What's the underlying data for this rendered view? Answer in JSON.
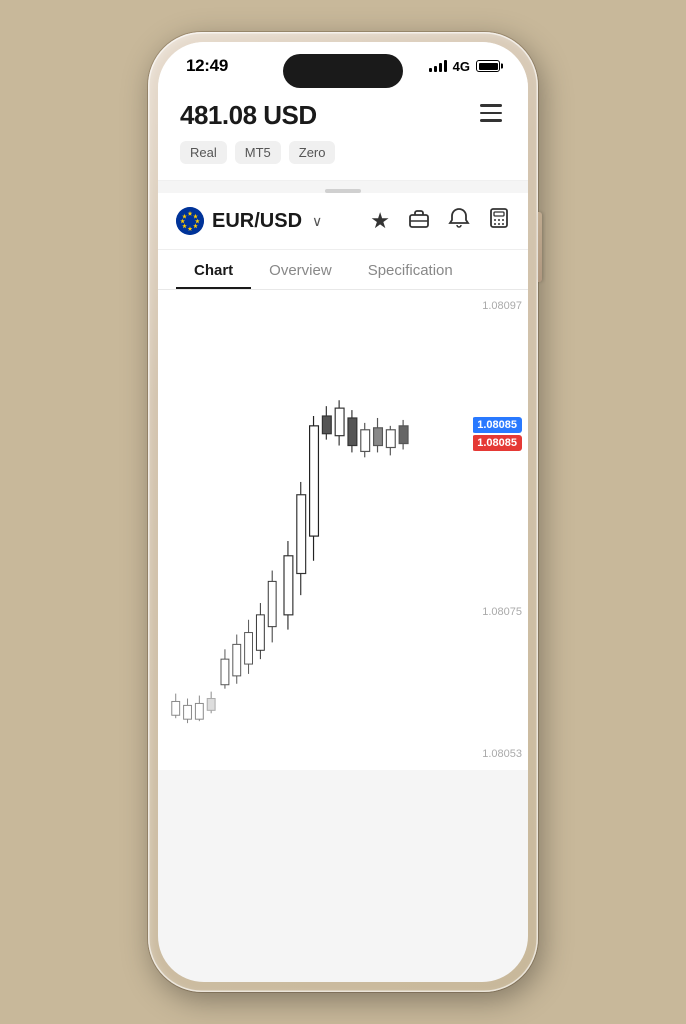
{
  "phone": {
    "status_bar": {
      "time": "12:49",
      "signal_label": "4G",
      "battery_level": "full"
    },
    "account": {
      "balance": "481.08 USD",
      "tags": [
        "Real",
        "MT5",
        "Zero"
      ],
      "menu_label": "menu"
    },
    "instrument": {
      "name": "EUR/USD",
      "flag_emoji": "🇪🇺",
      "dropdown_label": "expand"
    },
    "actions": {
      "star_icon": "★",
      "briefcase_icon": "💼",
      "bell_icon": "🔔",
      "calculator_icon": "🧮"
    },
    "tabs": [
      {
        "label": "Chart",
        "active": true
      },
      {
        "label": "Overview",
        "active": false
      },
      {
        "label": "Specification",
        "active": false
      }
    ],
    "chart": {
      "price_levels": [
        "1.08097",
        "1.08085",
        "1.08075",
        "1.08053"
      ],
      "current_bid": "1.08085",
      "current_ask": "1.08085",
      "dashed_line_price": "1.08085"
    }
  }
}
